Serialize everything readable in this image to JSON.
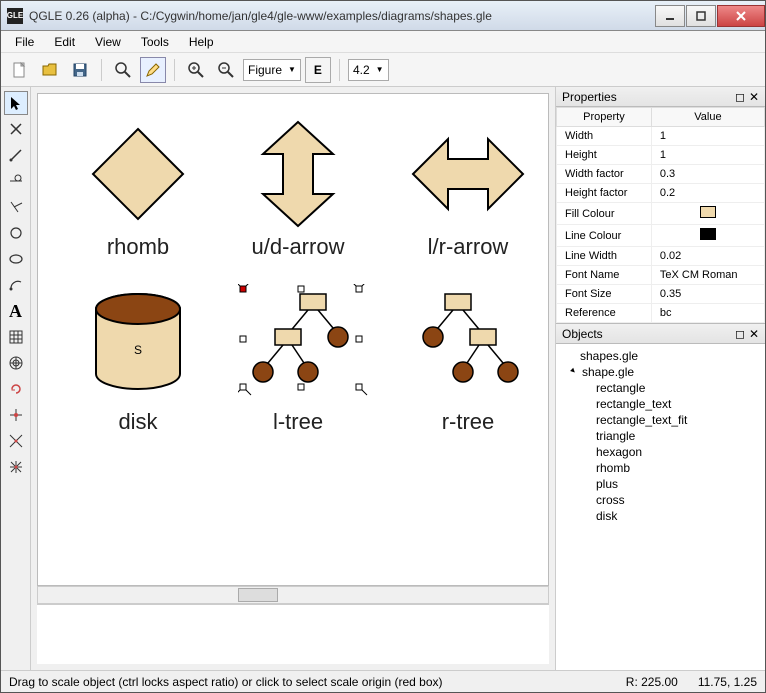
{
  "window": {
    "title": "QGLE 0.26 (alpha) - C:/Cygwin/home/jan/gle4/gle-www/examples/diagrams/shapes.gle",
    "icon_text": "GLE"
  },
  "menu": {
    "file": "File",
    "edit": "Edit",
    "view": "View",
    "tools": "Tools",
    "help": "Help"
  },
  "toolbar": {
    "combo_figure": "Figure",
    "combo_zoom": "4.2",
    "combo_e": "E"
  },
  "canvas": {
    "labels": {
      "rhomb": "rhomb",
      "ud_arrow": "u/d-arrow",
      "lr_arrow": "l/r-arrow",
      "disk": "disk",
      "ltree": "l-tree",
      "rtree": "r-tree",
      "disk_letter": "S"
    },
    "colors": {
      "fill": "#EFD9AD",
      "brown": "#8B4513",
      "stroke": "#000000"
    }
  },
  "props": {
    "header": "Properties",
    "col_property": "Property",
    "col_value": "Value",
    "rows": [
      {
        "k": "Width",
        "v": "1"
      },
      {
        "k": "Height",
        "v": "1"
      },
      {
        "k": "Width factor",
        "v": "0.3"
      },
      {
        "k": "Height factor",
        "v": "0.2"
      },
      {
        "k": "Fill Colour",
        "v": "#EFD9AD",
        "swatch": true
      },
      {
        "k": "Line Colour",
        "v": "#000000",
        "swatch": true
      },
      {
        "k": "Line Width",
        "v": "0.02"
      },
      {
        "k": "Font Name",
        "v": "TeX CM Roman"
      },
      {
        "k": "Font Size",
        "v": "0.35"
      },
      {
        "k": "Reference",
        "v": "bc"
      }
    ]
  },
  "objects": {
    "header": "Objects",
    "items": [
      "shapes.gle",
      "shape.gle",
      "rectangle",
      "rectangle_text",
      "rectangle_text_fit",
      "triangle",
      "hexagon",
      "rhomb",
      "plus",
      "cross",
      "disk"
    ]
  },
  "status": {
    "text": "Drag to scale object (ctrl locks aspect ratio) or click to select scale origin (red box)",
    "R": "R:  225.00",
    "coords": "11.75, 1.25"
  }
}
